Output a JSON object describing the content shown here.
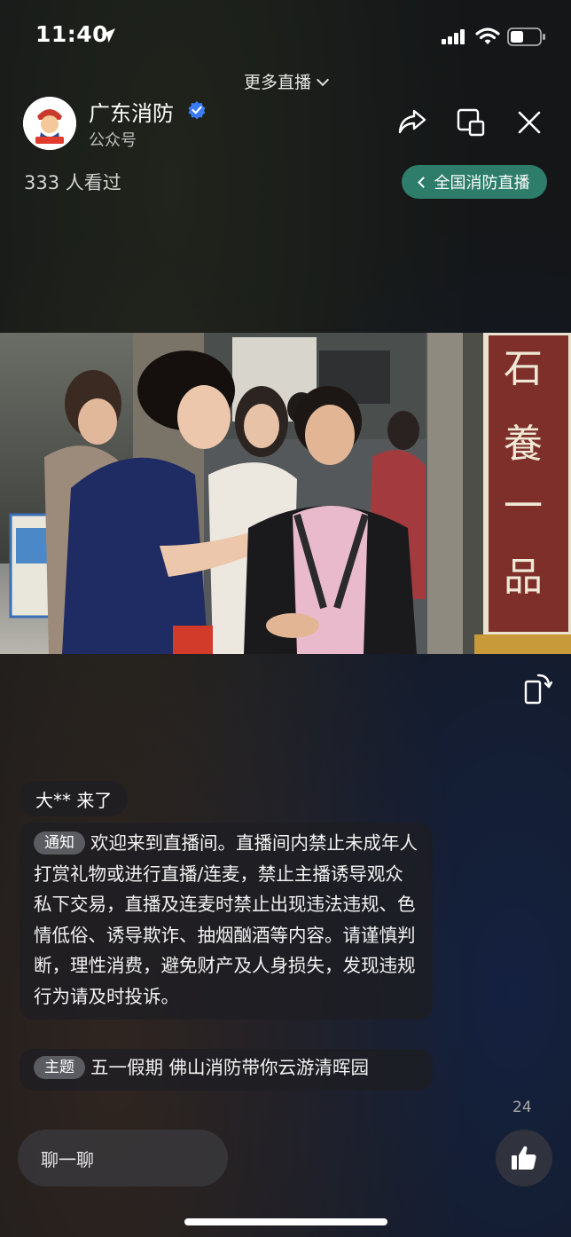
{
  "status_bar": {
    "time": "11:40"
  },
  "header": {
    "more_live": "更多直播",
    "account_name": "广东消防",
    "account_type": "公众号",
    "viewers": "333 人看过",
    "national_button": "全国消防直播"
  },
  "chat": {
    "join_message": "大** 来了",
    "notice_tag": "通知",
    "notice_text": "欢迎来到直播间。直播间内禁止未成年人打赏礼物或进行直播/连麦，禁止主播诱导观众私下交易，直播及连麦时禁止出现违法违规、色情低俗、诱导欺诈、抽烟酗酒等内容。请谨慎判断，理性消费，避免财产及人身损失，发现违规行为请及时投诉。",
    "topic_tag": "主题",
    "topic_text": "五一假期 佛山消防带你云游清晖园"
  },
  "footer": {
    "like_count": "24",
    "chat_placeholder": "聊一聊"
  },
  "video_sign": {
    "line1": "石",
    "line2": "養",
    "line3": "一",
    "line4": "品"
  },
  "colors": {
    "accent_green": "#2d7d6a",
    "verified_blue": "#3a7cf5"
  }
}
